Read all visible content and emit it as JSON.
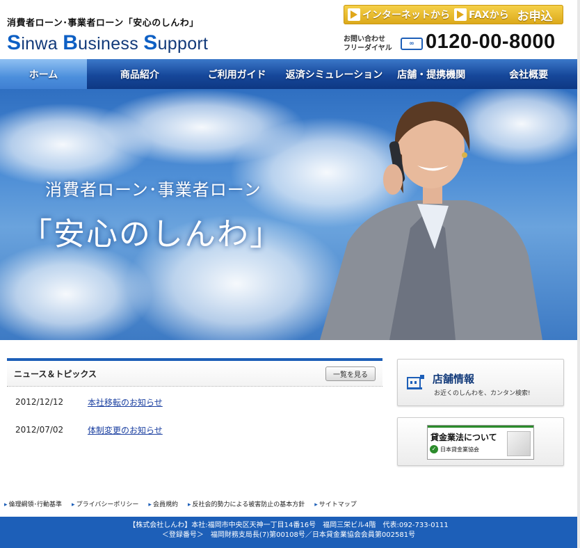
{
  "header": {
    "tagline": "消費者ローン･事業者ローン「安心のしんわ」",
    "brand": [
      {
        "cap": "S",
        "rest": "inwa "
      },
      {
        "cap": "B",
        "rest": "usiness "
      },
      {
        "cap": "S",
        "rest": "upport"
      }
    ],
    "apply_internet": "インターネットから",
    "apply_fax": "FAXから",
    "apply_label": "お申込",
    "contact_line1": "お問い合わせ",
    "contact_line2": "フリーダイヤル",
    "freedial_icon_text": "∞",
    "phone": "0120-00-8000"
  },
  "nav": {
    "items": [
      {
        "label": "ホーム"
      },
      {
        "label": "商品紹介"
      },
      {
        "label": "ご利用ガイド"
      },
      {
        "label": "返済シミュレーション"
      },
      {
        "label": "店舗・提携機関"
      },
      {
        "label": "会社概要"
      }
    ]
  },
  "hero": {
    "subtitle": "消費者ローン･事業者ローン",
    "title": "「安心のしんわ」"
  },
  "news": {
    "title": "ニュース＆トピックス",
    "more_label": "一覧を見る",
    "items": [
      {
        "date": "2012/12/12",
        "text": "本社移転のお知らせ"
      },
      {
        "date": "2012/07/02",
        "text": "体制変更のお知らせ"
      }
    ]
  },
  "store": {
    "title": "店舗情報",
    "desc": "お近くのしんわを、カンタン検索!"
  },
  "law_banner": {
    "title": "貸金業法について",
    "sub": "日本貸金業協会"
  },
  "footer": {
    "links": [
      {
        "label": "倫理綱領･行動基準"
      },
      {
        "label": "プライバシーポリシー"
      },
      {
        "label": "会員規約"
      },
      {
        "label": "反社会的勢力による被害防止の基本方針"
      },
      {
        "label": "サイトマップ"
      }
    ],
    "line1": "【株式会社しんわ】本社:福岡市中央区天神一丁目14番16号　福岡三栄ビル4階　代表:092-733-0111",
    "line2": "＜登録番号＞　福岡財務支局長(7)第00108号／日本貸金業協会会員第002581号"
  },
  "colors": {
    "accent_blue": "#1d5fb8",
    "nav_blue": "#16479a",
    "apply_gold": "#e0a71a"
  }
}
